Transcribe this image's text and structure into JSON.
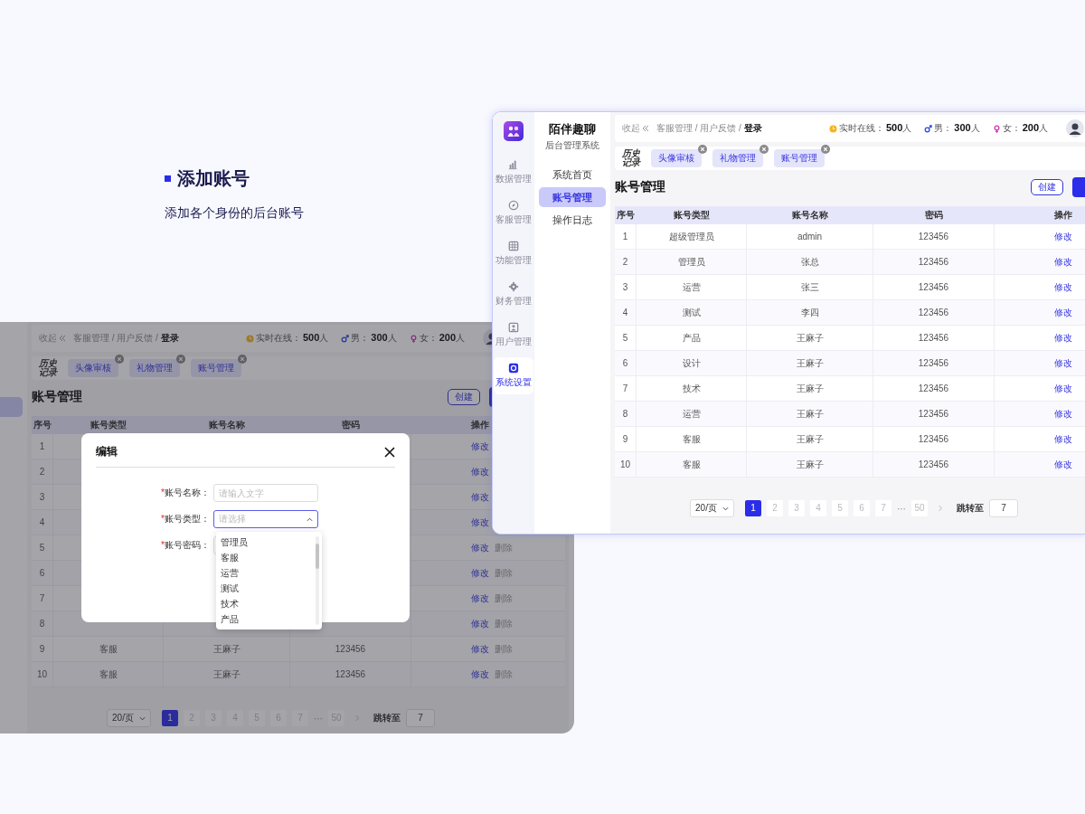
{
  "intro": {
    "title": "添加账号",
    "subtitle": "添加各个身份的后台账号"
  },
  "list_screen": {
    "app": {
      "name": "陌伴趣聊",
      "subtitle": "后台管理系统"
    },
    "rail": [
      {
        "label": "数据管理",
        "selected": false
      },
      {
        "label": "客服管理",
        "selected": false
      },
      {
        "label": "功能管理",
        "selected": false
      },
      {
        "label": "财务管理",
        "selected": false
      },
      {
        "label": "用户管理",
        "selected": false
      },
      {
        "label": "系统设置",
        "selected": true
      }
    ],
    "menu": [
      {
        "label": "系统首页",
        "selected": false
      },
      {
        "label": "账号管理",
        "selected": true
      },
      {
        "label": "操作日志",
        "selected": false
      }
    ],
    "header": {
      "collapse": "收起",
      "breadcrumb": "客服管理 / 用户反馈 / **登录**",
      "stats": [
        {
          "kind": "online",
          "label": "实时在线：",
          "value": "**500**人"
        },
        {
          "kind": "male",
          "label": "男：",
          "value": "**300**人"
        },
        {
          "kind": "female",
          "label": "女：",
          "value": "**200**人"
        }
      ]
    },
    "history_label": "历史记录",
    "tags": [
      "头像审核",
      "礼物管理",
      "账号管理"
    ],
    "title": "账号管理",
    "create": "创建",
    "table": {
      "columns": [
        "序号",
        "账号类型",
        "账号名称",
        "密码",
        "操作"
      ],
      "rows": [
        {
          "index": "1",
          "type": "超级管理员",
          "name": "admin",
          "password": "123456",
          "edit": "修改"
        },
        {
          "index": "2",
          "type": "管理员",
          "name": "张总",
          "password": "123456",
          "edit": "修改"
        },
        {
          "index": "3",
          "type": "运营",
          "name": "张三",
          "password": "123456",
          "edit": "修改"
        },
        {
          "index": "4",
          "type": "测试",
          "name": "李四",
          "password": "123456",
          "edit": "修改"
        },
        {
          "index": "5",
          "type": "产品",
          "name": "王麻子",
          "password": "123456",
          "edit": "修改"
        },
        {
          "index": "6",
          "type": "设计",
          "name": "王麻子",
          "password": "123456",
          "edit": "修改"
        },
        {
          "index": "7",
          "type": "技术",
          "name": "王麻子",
          "password": "123456",
          "edit": "修改"
        },
        {
          "index": "8",
          "type": "运营",
          "name": "王麻子",
          "password": "123456",
          "edit": "修改"
        },
        {
          "index": "9",
          "type": "客服",
          "name": "王麻子",
          "password": "123456",
          "edit": "修改"
        },
        {
          "index": "10",
          "type": "客服",
          "name": "王麻子",
          "password": "123456",
          "edit": "修改"
        }
      ]
    },
    "pagination": {
      "page_size": "20/页",
      "pages": [
        {
          "label": "1",
          "selected": true
        },
        {
          "label": "2",
          "selected": false
        },
        {
          "label": "3",
          "selected": false
        },
        {
          "label": "4",
          "selected": false
        },
        {
          "label": "5",
          "selected": false
        },
        {
          "label": "6",
          "selected": false
        },
        {
          "label": "7",
          "selected": false
        }
      ],
      "ellipsis": "···",
      "last_page": {
        "label": "50",
        "selected": false
      },
      "jump_label": "跳转至",
      "jump_value": "7"
    }
  },
  "edit_screen": {
    "menu": [
      {
        "selected": false
      },
      {
        "selected": true
      },
      {
        "selected": false
      }
    ],
    "header": {
      "collapse": "收起",
      "breadcrumb": "客服管理 / 用户反馈 / **登录**",
      "stats": [
        {
          "kind": "online",
          "label": "实时在线：",
          "value": "**500**人"
        },
        {
          "kind": "male",
          "label": "男：",
          "value": "**300**人"
        },
        {
          "kind": "female",
          "label": "女：",
          "value": "**200**人"
        }
      ]
    },
    "history_label": "历史记录",
    "tags": [
      "头像审核",
      "礼物管理",
      "账号管理"
    ],
    "title": "账号管理",
    "create": "创建",
    "table": {
      "columns": [
        "序号",
        "账号类型",
        "账号名称",
        "密码",
        "操作"
      ],
      "rows": [
        {
          "index": "1",
          "edit": "修改"
        },
        {
          "index": "2",
          "edit": "修改"
        },
        {
          "index": "3",
          "edit": "修改"
        },
        {
          "index": "4",
          "edit": "修改"
        },
        {
          "index": "5",
          "edit": "修改",
          "delete": "删除"
        },
        {
          "index": "6",
          "edit": "修改",
          "delete": "删除"
        },
        {
          "index": "7",
          "edit": "修改",
          "delete": "删除"
        },
        {
          "index": "8",
          "edit": "修改",
          "delete": "删除"
        },
        {
          "index": "9",
          "type": "客服",
          "name": "王麻子",
          "password": "123456",
          "edit": "修改",
          "delete": "删除"
        },
        {
          "index": "10",
          "type": "客服",
          "name": "王麻子",
          "password": "123456",
          "edit": "修改",
          "delete": "删除"
        }
      ]
    },
    "pagination": {
      "page_size": "20/页",
      "pages": [
        {
          "label": "1",
          "selected": true
        },
        {
          "label": "2",
          "selected": false
        },
        {
          "label": "3",
          "selected": false
        },
        {
          "label": "4",
          "selected": false
        },
        {
          "label": "5",
          "selected": false
        },
        {
          "label": "6",
          "selected": false
        },
        {
          "label": "7",
          "selected": false
        }
      ],
      "ellipsis": "···",
      "last_page": {
        "label": "50",
        "selected": false
      },
      "jump_label": "跳转至",
      "jump_value": "7"
    },
    "dialog": {
      "title": "编辑",
      "fields": [
        {
          "kind": "input",
          "mark": "*",
          "label": "账号名称：",
          "placeholder": "请输入文字"
        },
        {
          "kind": "select",
          "mark": "*",
          "label": "账号类型：",
          "placeholder": "请选择",
          "expanded": true,
          "options": [
            "管理员",
            "客服",
            "运营",
            "测试",
            "技术",
            "产品"
          ]
        },
        {
          "kind": "input",
          "mark": "*",
          "label": "账号密码："
        }
      ]
    }
  }
}
